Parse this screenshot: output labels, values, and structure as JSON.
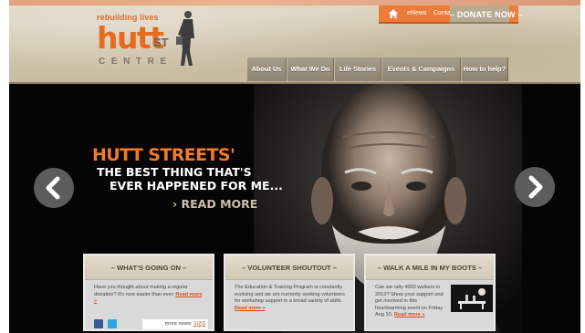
{
  "header": {
    "tagline": "rebuilding lives",
    "logo_word": "hutt",
    "logo_st": "ST",
    "logo_centre": "CENTRE",
    "utility": {
      "enews": "eNews",
      "contact": "Contact"
    },
    "donate": "– DONATE NOW –"
  },
  "nav": {
    "items": [
      {
        "label": "About Us"
      },
      {
        "label": "What We Do"
      },
      {
        "label": "Life Stories"
      },
      {
        "label": "Events & Campaigns"
      },
      {
        "label": "How to help?"
      }
    ]
  },
  "hero": {
    "line1": "HUTT STREETS'",
    "line2": "THE BEST THING THAT'S",
    "line3": "EVER HAPPENED FOR ME...",
    "read_more": "› READ MORE"
  },
  "boxes": [
    {
      "title": "– WHAT'S GOING ON –",
      "body": "Have you thought about making a regular donation? It's now easier than ever.",
      "link": "Read more »",
      "more_news_label": "more news:",
      "pages": [
        "1",
        "2",
        "3"
      ]
    },
    {
      "title": "– VOLUNTEER SHOUTOUT –",
      "body": "The Education & Training Program is constantly evolving and we are currently seeking volunteers for workshop support in a broad variety of skills.",
      "link": "Read more »"
    },
    {
      "title": "– WALK A MILE IN MY BOOTS –",
      "body": "Can we rally 4000 walkers in 2012? Show your support and get involved in this heartwarming event on Friday Aug 10.",
      "link": "Read more »"
    }
  ],
  "colors": {
    "brand_orange": "#ed7b3a",
    "nav_bg": "#8c826f",
    "link": "#d24b17"
  }
}
